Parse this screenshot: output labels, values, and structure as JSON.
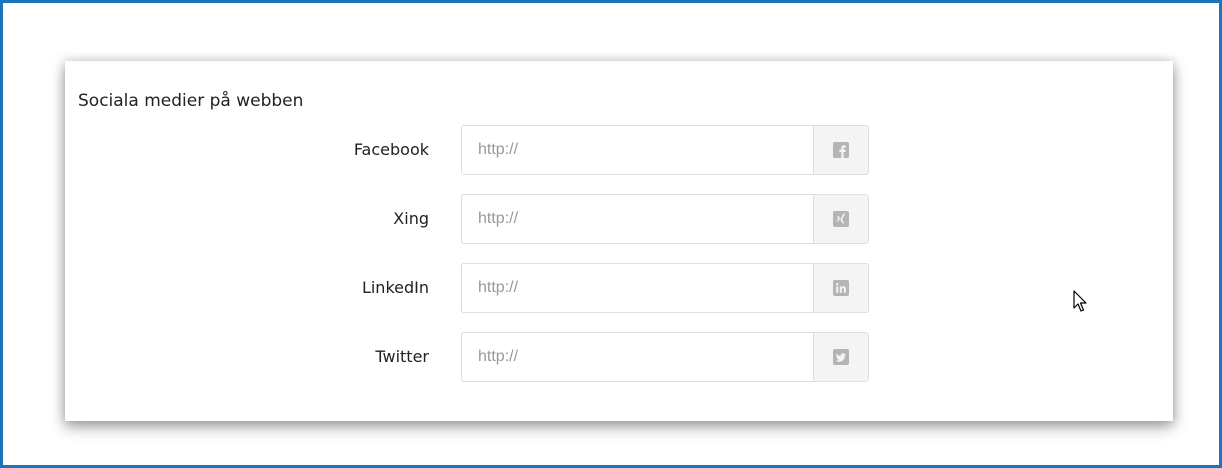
{
  "section": {
    "title": "Sociala medier på webben"
  },
  "fields": [
    {
      "label": "Facebook",
      "placeholder": "http://",
      "icon": "facebook-icon"
    },
    {
      "label": "Xing",
      "placeholder": "http://",
      "icon": "xing-icon"
    },
    {
      "label": "LinkedIn",
      "placeholder": "http://",
      "icon": "linkedin-icon"
    },
    {
      "label": "Twitter",
      "placeholder": "http://",
      "icon": "twitter-icon"
    }
  ],
  "colors": {
    "frame_border": "#1b75bb",
    "icon_gray": "#b5b5b5",
    "addon_bg": "#f4f4f4"
  }
}
